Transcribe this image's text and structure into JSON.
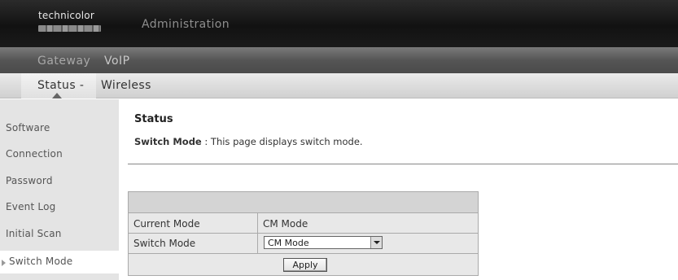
{
  "header": {
    "logo_text": "technicolor",
    "title": "Administration"
  },
  "nav_primary": {
    "items": [
      "Gateway",
      "VoIP"
    ]
  },
  "nav_secondary": {
    "status_label": "Status -",
    "wireless_label": "Wireless"
  },
  "sidebar": {
    "items": [
      "Software",
      "Connection",
      "Password",
      "Event Log",
      "Initial Scan",
      "Switch Mode"
    ],
    "active": "Switch Mode"
  },
  "main": {
    "title": "Status",
    "desc_label": "Switch Mode",
    "desc_sep": " : ",
    "desc_text": "This page displays switch mode."
  },
  "table": {
    "current_mode_label": "Current Mode",
    "current_mode_value": "CM Mode",
    "switch_mode_label": "Switch Mode",
    "switch_mode_selected": "CM Mode",
    "apply_label": "Apply"
  },
  "icons": {
    "logo": "technicolor-logo-icon",
    "nav_indicator": "triangle-up-icon",
    "active_indicator": "triangle-right-icon",
    "dropdown": "chevron-down-icon"
  }
}
